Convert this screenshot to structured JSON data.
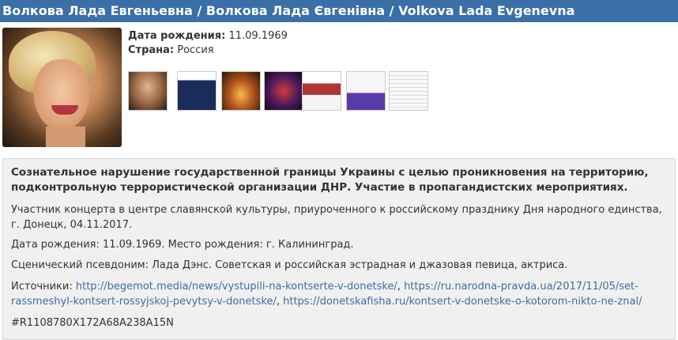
{
  "header": {
    "title": "Волкова Лада Евгеньевна / Волкова Лада Євгенівна / Volkova Lada Evgenevna"
  },
  "profile": {
    "dob_label": "Дата рождения:",
    "dob_value": "11.09.1969",
    "country_label": "Страна:",
    "country_value": "Россия"
  },
  "thumbnails_count": 7,
  "description": {
    "title": "Сознательное нарушение государственной границы Украины с целью проникновения на территорию, подконтрольную террористической организации ДНР. Участие в пропагандистских мероприятиях.",
    "paragraph_1": "Участник концерта в центре славянской культуры, приуроченного к российскому празднику Дня народного единства, г. Донецк, 04.11.2017.",
    "paragraph_2": "Дата рождения: 11.09.1969. Место рождения: г. Калининград.",
    "paragraph_3": "Сценический псевдоним: Лада Дэнс. Советская и российская эстрадная и джазовая певица, актриса.",
    "sources_label": "Источники:",
    "source_1": "http://begemot.media/news/vystupili-na-kontserte-v-donetske/",
    "source_2": "https://ru.narodna-pravda.ua/2017/11/05/set-rassmeshyl-kontsert-rossyjskoj-pevytsy-v-donetske/",
    "source_3": "https://donetskafisha.ru/kontsert-v-donetske-o-kotorom-nikto-ne-znal/",
    "hash": "#R1108780X172A68A238A15N"
  },
  "colors": {
    "title_bar": "#3b6fa8",
    "link": "#3b6fa8",
    "description_bg": "#f0f0f0"
  }
}
